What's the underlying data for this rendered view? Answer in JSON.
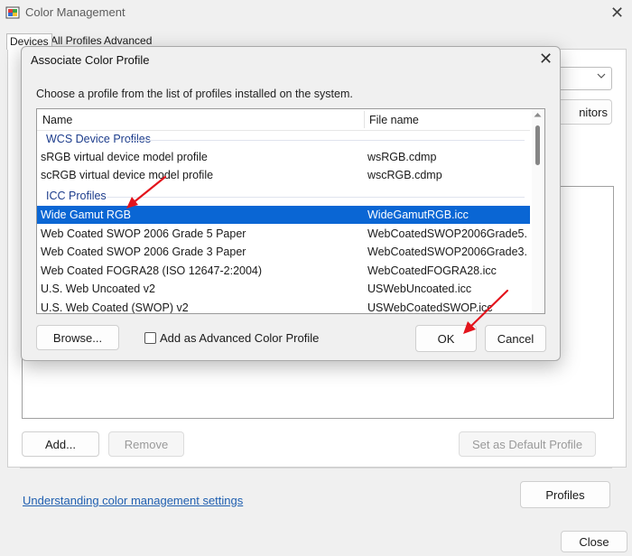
{
  "window": {
    "title": "Color Management",
    "close_glyph": "✕"
  },
  "tabs": [
    {
      "label": "Devices",
      "active": true
    },
    {
      "label": "All Profiles",
      "active": false
    },
    {
      "label": "Advanced",
      "active": false
    }
  ],
  "main": {
    "monitors_button_partial": "nitors",
    "add_label": "Add...",
    "remove_label": "Remove",
    "set_default_label": "Set as Default Profile",
    "help_link": "Understanding color management settings",
    "profiles_label": "Profiles",
    "close_label": "Close"
  },
  "dialog": {
    "title": "Associate Color Profile",
    "close_glyph": "✕",
    "instructions": "Choose a profile from the list of profiles installed on the system.",
    "columns": {
      "name": "Name",
      "file": "File name"
    },
    "groups": {
      "wcs": "WCS Device Profiles",
      "icc": "ICC Profiles"
    },
    "wcs_rows": [
      {
        "name": "sRGB virtual device model profile",
        "file": "wsRGB.cdmp"
      },
      {
        "name": "scRGB virtual device model profile",
        "file": "wscRGB.cdmp"
      }
    ],
    "icc_rows": [
      {
        "name": "Wide Gamut RGB",
        "file": "WideGamutRGB.icc",
        "selected": true
      },
      {
        "name": "Web Coated SWOP 2006 Grade 5 Paper",
        "file": "WebCoatedSWOP2006Grade5..."
      },
      {
        "name": "Web Coated SWOP 2006 Grade 3 Paper",
        "file": "WebCoatedSWOP2006Grade3..."
      },
      {
        "name": "Web Coated FOGRA28 (ISO 12647-2:2004)",
        "file": "WebCoatedFOGRA28.icc"
      },
      {
        "name": "U.S. Web Uncoated v2",
        "file": "USWebUncoated.icc"
      },
      {
        "name": "U.S. Web Coated (SWOP) v2",
        "file": "USWebCoatedSWOP.icc"
      }
    ],
    "browse_label": "Browse...",
    "advanced_checkbox_label": "Add as Advanced Color Profile",
    "advanced_checked": false,
    "ok_label": "OK",
    "cancel_label": "Cancel"
  },
  "colors": {
    "selection": "#0a66d4",
    "group_heading": "#1d3d8c",
    "link": "#1f5fb0",
    "annotation_arrow": "#e3141c"
  },
  "icons": {
    "app": "color-management-icon",
    "dropdown": "chevron-down-icon",
    "scroll_up": "scroll-up-arrow-icon"
  }
}
